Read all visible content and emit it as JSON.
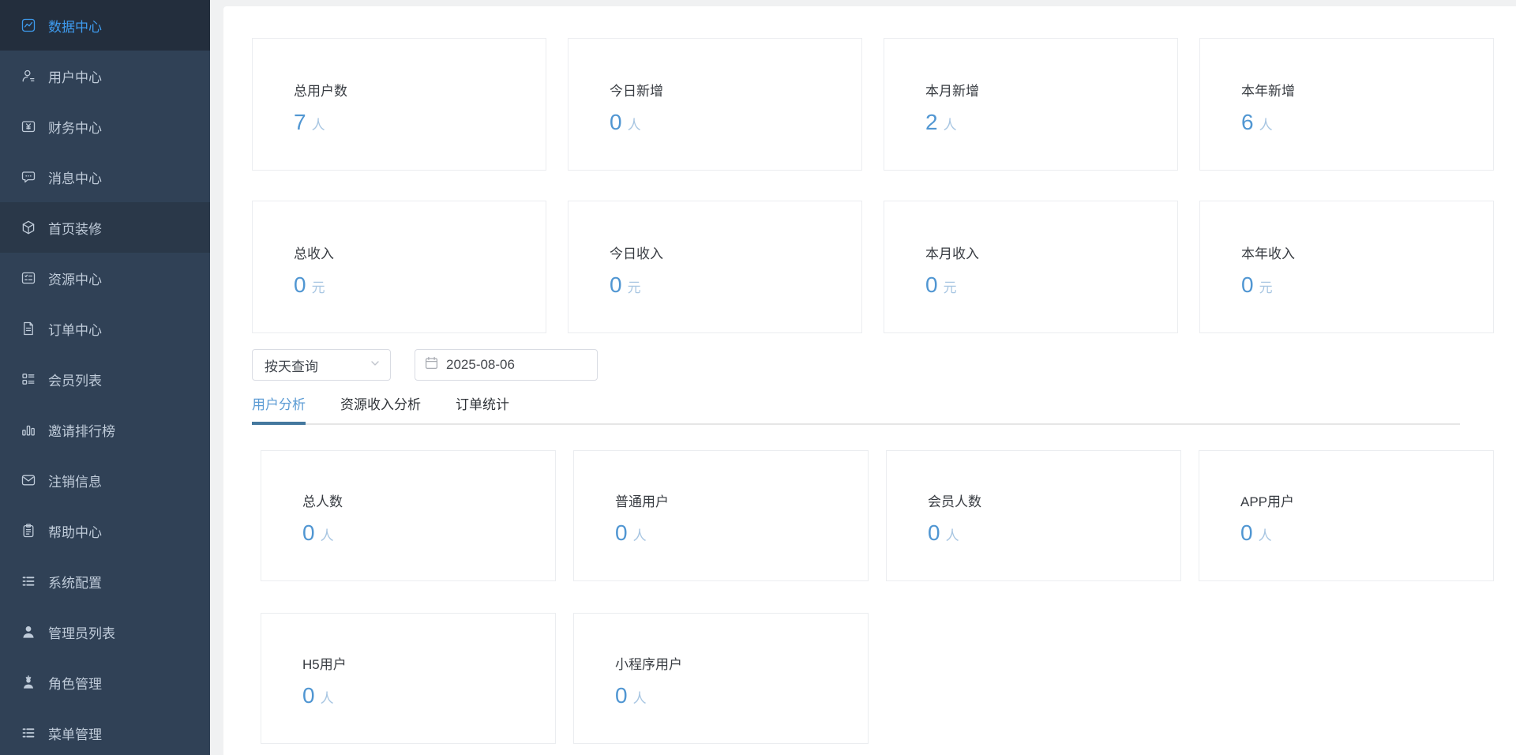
{
  "sidebar": {
    "items": [
      {
        "label": "数据中心",
        "icon": "trend-chart-icon",
        "state": "active"
      },
      {
        "label": "用户中心",
        "icon": "user-icon",
        "state": "normal"
      },
      {
        "label": "财务中心",
        "icon": "finance-box-icon",
        "state": "normal"
      },
      {
        "label": "消息中心",
        "icon": "message-bubble-icon",
        "state": "normal"
      },
      {
        "label": "首页装修",
        "icon": "cube-icon",
        "state": "hovered"
      },
      {
        "label": "资源中心",
        "icon": "resource-list-icon",
        "state": "normal"
      },
      {
        "label": "订单中心",
        "icon": "order-document-icon",
        "state": "normal"
      },
      {
        "label": "会员列表",
        "icon": "member-list-icon",
        "state": "normal"
      },
      {
        "label": "邀请排行榜",
        "icon": "bar-chart-icon",
        "state": "normal"
      },
      {
        "label": "注销信息",
        "icon": "mail-icon",
        "state": "normal"
      },
      {
        "label": "帮助中心",
        "icon": "clipboard-icon",
        "state": "normal"
      },
      {
        "label": "系统配置",
        "icon": "menu-lines-icon",
        "state": "normal"
      },
      {
        "label": "管理员列表",
        "icon": "admin-person-icon",
        "state": "normal"
      },
      {
        "label": "角色管理",
        "icon": "role-person-icon",
        "state": "normal"
      },
      {
        "label": "菜单管理",
        "icon": "menu-lines-icon",
        "state": "normal"
      }
    ]
  },
  "overview_cards": [
    {
      "label": "总用户数",
      "value": "7",
      "unit": "人"
    },
    {
      "label": "今日新增",
      "value": "0",
      "unit": "人"
    },
    {
      "label": "本月新增",
      "value": "2",
      "unit": "人"
    },
    {
      "label": "本年新增",
      "value": "6",
      "unit": "人"
    },
    {
      "label": "总收入",
      "value": "0",
      "unit": "元"
    },
    {
      "label": "今日收入",
      "value": "0",
      "unit": "元"
    },
    {
      "label": "本月收入",
      "value": "0",
      "unit": "元"
    },
    {
      "label": "本年收入",
      "value": "0",
      "unit": "元"
    }
  ],
  "filters": {
    "query_type": "按天查询",
    "date": "2025-08-06"
  },
  "tabs": [
    {
      "label": "用户分析",
      "active": true
    },
    {
      "label": "资源收入分析",
      "active": false
    },
    {
      "label": "订单统计",
      "active": false
    }
  ],
  "analysis_cards": [
    {
      "label": "总人数",
      "value": "0",
      "unit": "人"
    },
    {
      "label": "普通用户",
      "value": "0",
      "unit": "人"
    },
    {
      "label": "会员人数",
      "value": "0",
      "unit": "人"
    },
    {
      "label": "APP用户",
      "value": "0",
      "unit": "人"
    },
    {
      "label": "H5用户",
      "value": "0",
      "unit": "人"
    },
    {
      "label": "小程序用户",
      "value": "0",
      "unit": "人"
    }
  ],
  "colors": {
    "sidebar_bg": "#304156",
    "sidebar_active_bg": "#232e3d",
    "sidebar_text": "#bfcbd9",
    "accent_blue": "#3e9bee",
    "stat_value_blue": "#5096d2",
    "stat_unit_blue": "#a8c6e2",
    "tab_active_text": "#5b9bd4",
    "tab_indicator": "#44789e",
    "card_border": "#ebedf0",
    "input_border": "#d9dce3",
    "page_bg": "#f0f1f2"
  }
}
